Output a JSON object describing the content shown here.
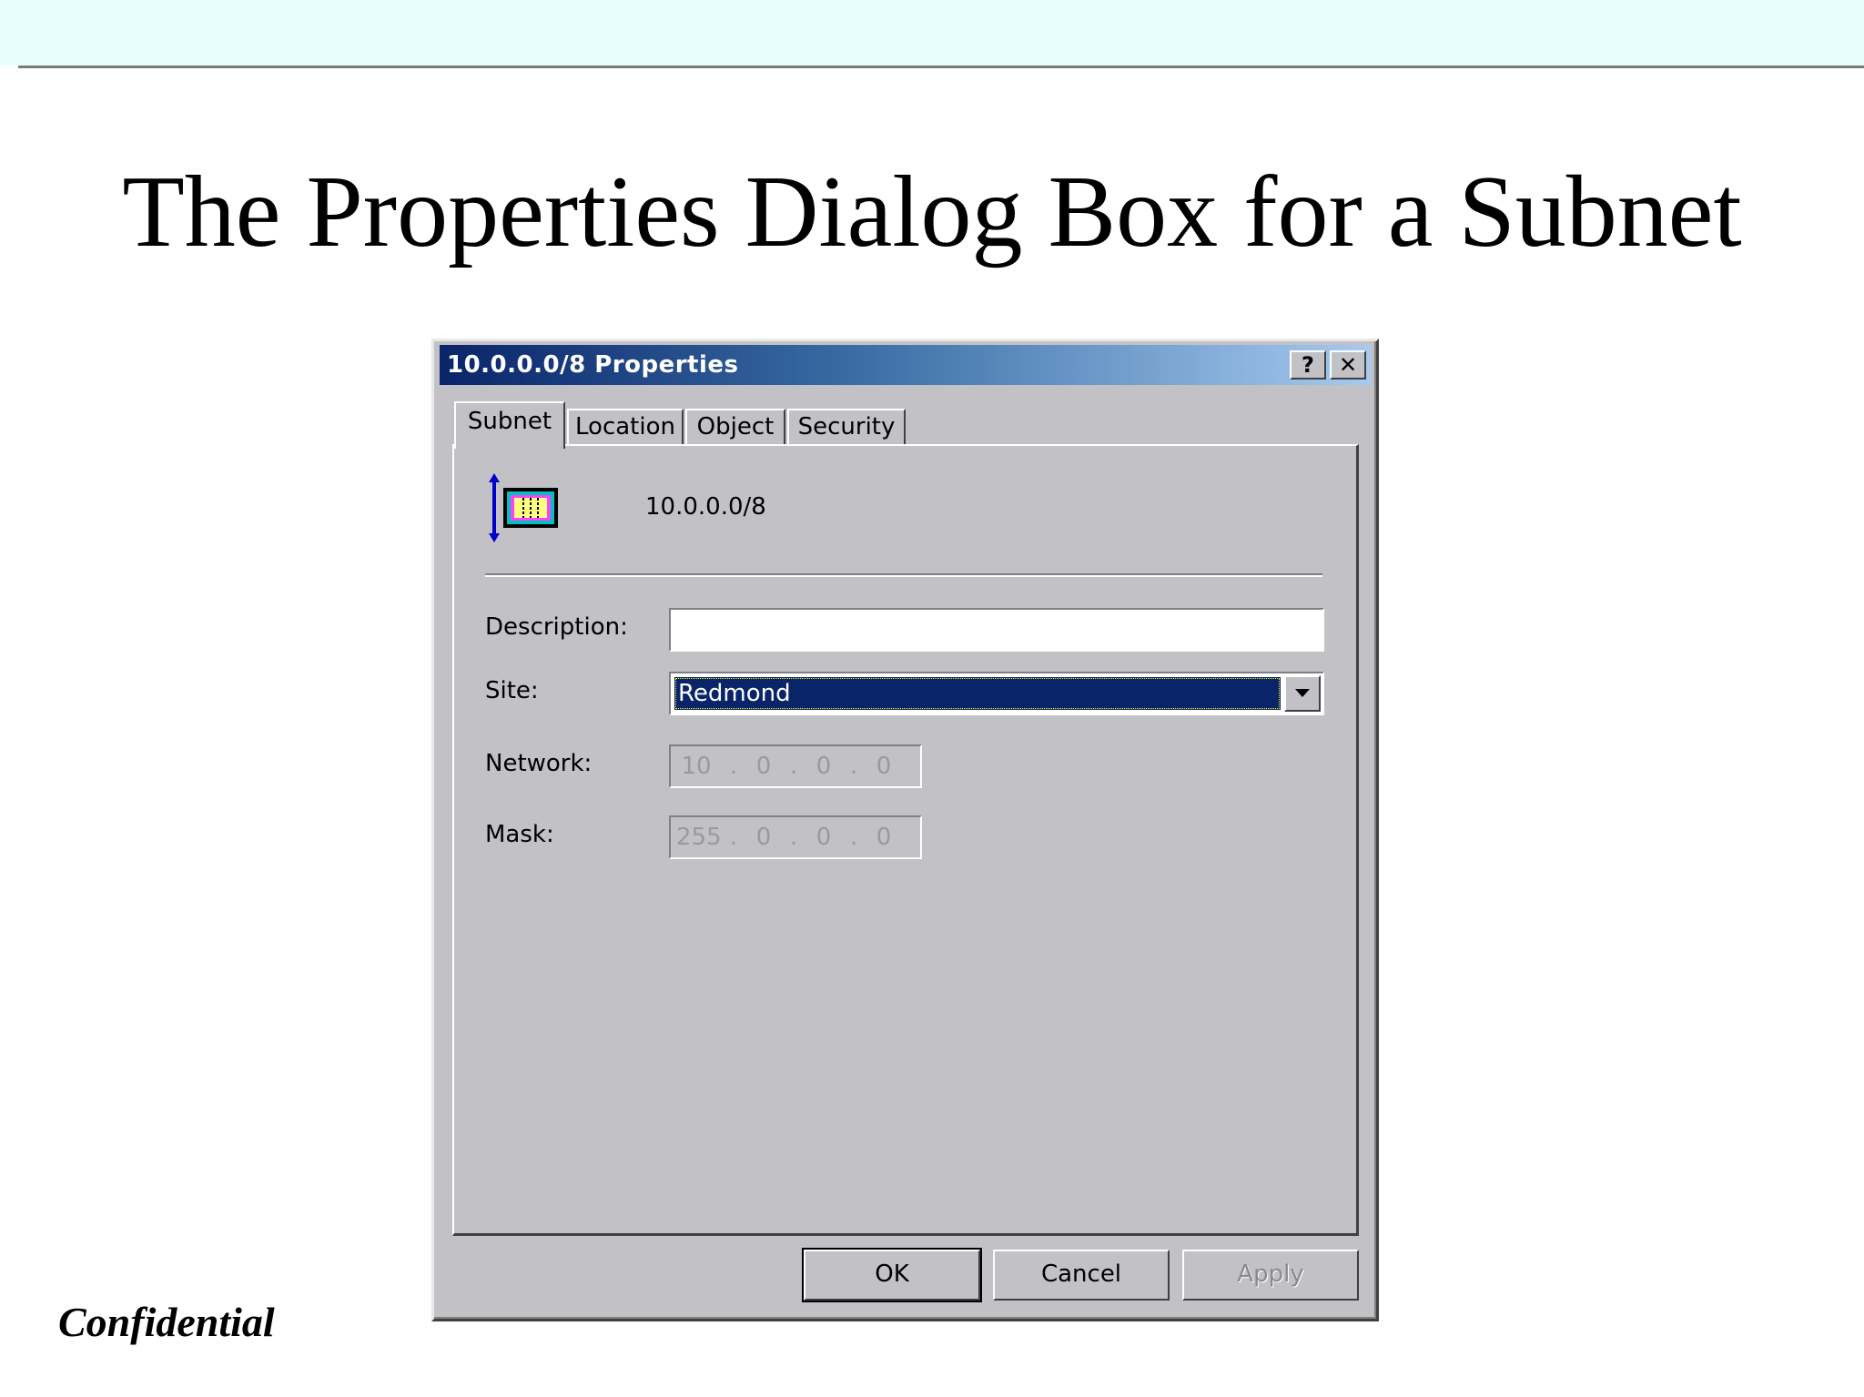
{
  "slide": {
    "title": "The Properties Dialog Box for a Subnet",
    "footer": "Confidential"
  },
  "dialog": {
    "title": "10.0.0.0/8 Properties",
    "help_button": "?",
    "close_button": "✕",
    "tabs": [
      {
        "label": "Subnet",
        "active": true
      },
      {
        "label": "Location",
        "active": false
      },
      {
        "label": "Object",
        "active": false
      },
      {
        "label": "Security",
        "active": false
      }
    ],
    "subnet_name": "10.0.0.0/8",
    "subnet_icon": "subnet-icon",
    "fields": {
      "description_label": "Description:",
      "description_value": "",
      "site_label": "Site:",
      "site_value": "Redmond",
      "network_label": "Network:",
      "network_octets": [
        "10",
        "0",
        "0",
        "0"
      ],
      "mask_label": "Mask:",
      "mask_octets": [
        "255",
        "0",
        "0",
        "0"
      ]
    },
    "buttons": {
      "ok": "OK",
      "cancel": "Cancel",
      "apply": "Apply"
    }
  },
  "colors": {
    "title_bar_start": "#0a246a",
    "title_bar_end": "#a6caf0",
    "selection": "#0a246a",
    "face": "#c2c1c5",
    "slide_band": "#e8fefe"
  }
}
